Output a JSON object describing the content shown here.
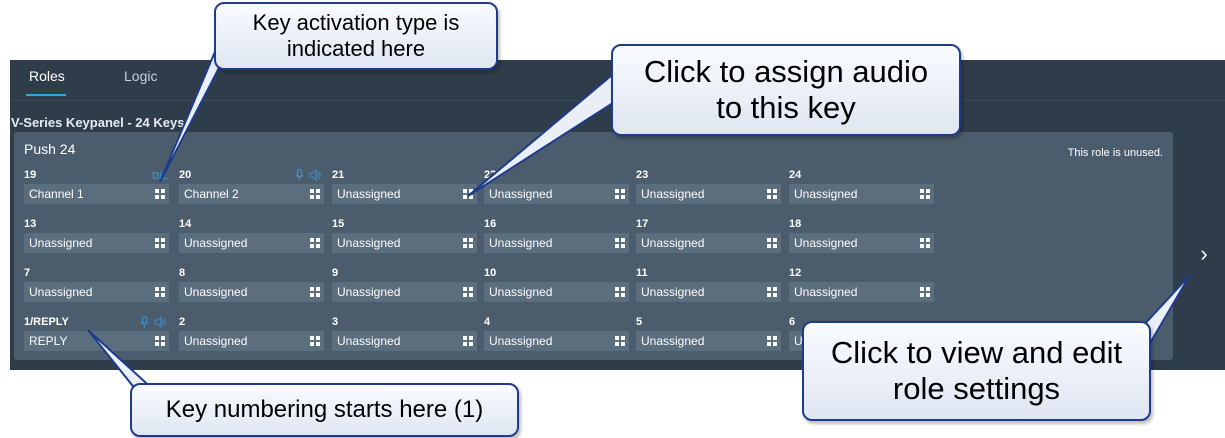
{
  "tabs": [
    {
      "label": "Roles",
      "active": true
    },
    {
      "label": "Logic",
      "active": false
    }
  ],
  "device_title": "V-Series Keypanel - 24 Keys",
  "role": {
    "name": "Push 24",
    "status": "This role is unused."
  },
  "keys": [
    {
      "number": "19",
      "label": "Channel 1",
      "activation_indicator": "D/L"
    },
    {
      "number": "20",
      "label": "Channel 2",
      "mic_icon": "mic-icon",
      "speaker_icon": "speaker-icon"
    },
    {
      "number": "21",
      "label": "Unassigned"
    },
    {
      "number": "22",
      "label": "Unassigned"
    },
    {
      "number": "23",
      "label": "Unassigned"
    },
    {
      "number": "24",
      "label": "Unassigned"
    },
    {
      "number": "13",
      "label": "Unassigned"
    },
    {
      "number": "14",
      "label": "Unassigned"
    },
    {
      "number": "15",
      "label": "Unassigned"
    },
    {
      "number": "16",
      "label": "Unassigned"
    },
    {
      "number": "17",
      "label": "Unassigned"
    },
    {
      "number": "18",
      "label": "Unassigned"
    },
    {
      "number": "7",
      "label": "Unassigned"
    },
    {
      "number": "8",
      "label": "Unassigned"
    },
    {
      "number": "9",
      "label": "Unassigned"
    },
    {
      "number": "10",
      "label": "Unassigned"
    },
    {
      "number": "11",
      "label": "Unassigned"
    },
    {
      "number": "12",
      "label": "Unassigned"
    },
    {
      "number": "1/REPLY",
      "label": "REPLY",
      "mic_icon": "mic-icon",
      "speaker_icon": "speaker-icon"
    },
    {
      "number": "2",
      "label": "Unassigned"
    },
    {
      "number": "3",
      "label": "Unassigned"
    },
    {
      "number": "4",
      "label": "Unassigned"
    },
    {
      "number": "5",
      "label": "Unassigned"
    },
    {
      "number": "6",
      "label": "Unassigned"
    }
  ],
  "callouts": {
    "activation": "Key activation type is\nindicated here",
    "assign_audio": "Click to assign audio\nto this key",
    "numbering": "Key numbering starts here (1)",
    "role_settings": "Click to view and edit\nrole settings"
  },
  "colors": {
    "panel_bg": "#2f3d4a",
    "card_bg": "#4b5d6d",
    "field_bg": "#5b6e7e",
    "accent": "#2aa8d8",
    "callout_border": "#1f3b8c"
  },
  "icons": {
    "assign": "assign-grid-icon",
    "next": "chevron-right-icon"
  }
}
